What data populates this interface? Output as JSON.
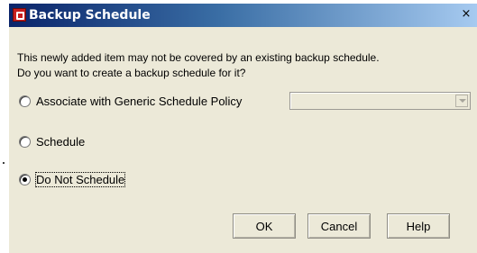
{
  "window": {
    "title": "Backup Schedule",
    "close_glyph": "×"
  },
  "message": {
    "line1": "This newly added item may not be covered by an existing backup schedule.",
    "line2": "Do you want to create a backup schedule for it?"
  },
  "options": [
    {
      "label": "Associate with Generic Schedule Policy",
      "selected": false
    },
    {
      "label": "Schedule",
      "selected": false
    },
    {
      "label": "Do Not Schedule",
      "selected": true
    }
  ],
  "policy_select": {
    "value": "",
    "enabled": false
  },
  "buttons": {
    "ok": "OK",
    "cancel": "Cancel",
    "help": "Help"
  },
  "colors": {
    "title_gradient_start": "#0a246a",
    "dialog_background": "#ece9d8"
  }
}
